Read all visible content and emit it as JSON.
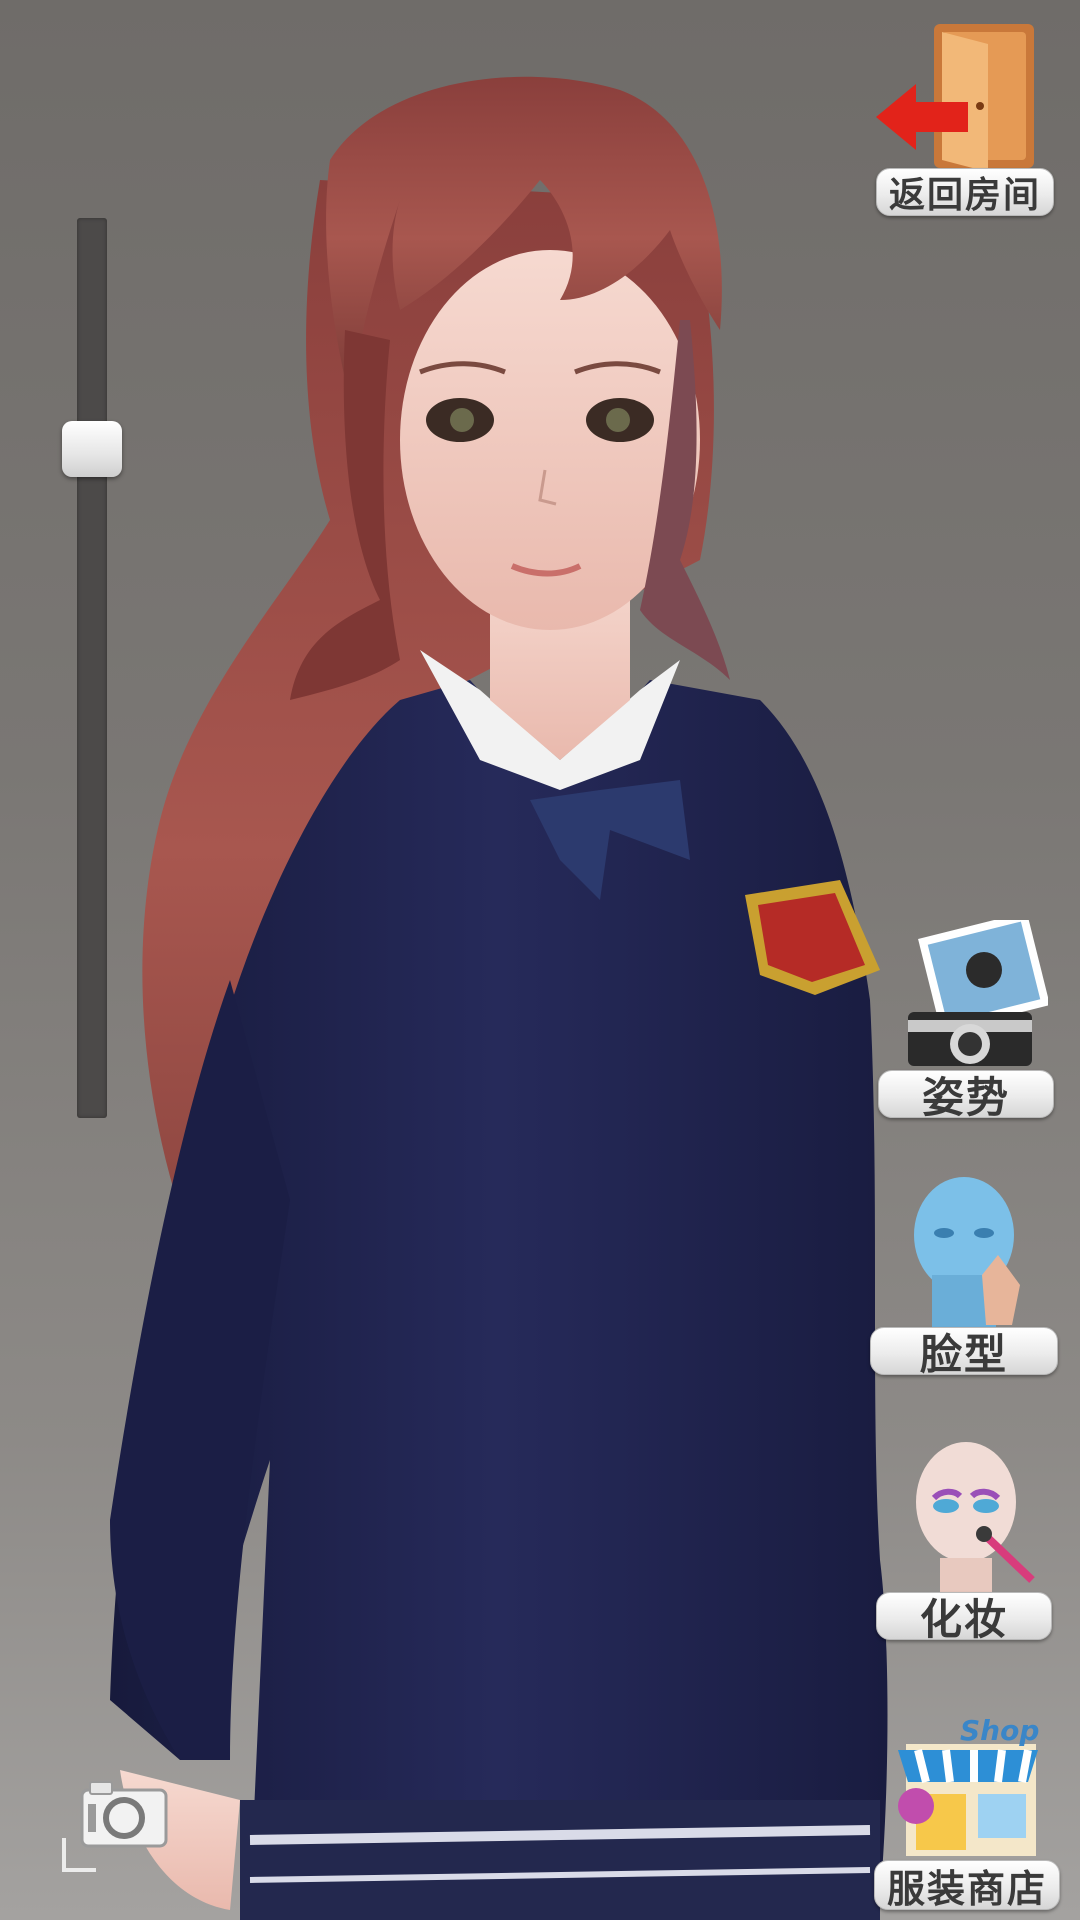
{
  "menu": {
    "exit_label": "返回房间",
    "pose_label": "姿势",
    "face_label": "脸型",
    "makeup_label": "化妆",
    "shop_label": "服装商店",
    "shop_sign_text": "Shop"
  },
  "slider": {
    "value": 0.24
  },
  "colors": {
    "background": "#7a7774",
    "sweater": "#1e2148",
    "hair": "#9b4a45",
    "button_text": "#3a3a3a"
  },
  "icons": [
    "exit-door-icon",
    "pose-camera-icon",
    "face-shape-icon",
    "makeup-icon",
    "shop-icon",
    "screenshot-camera-icon"
  ]
}
